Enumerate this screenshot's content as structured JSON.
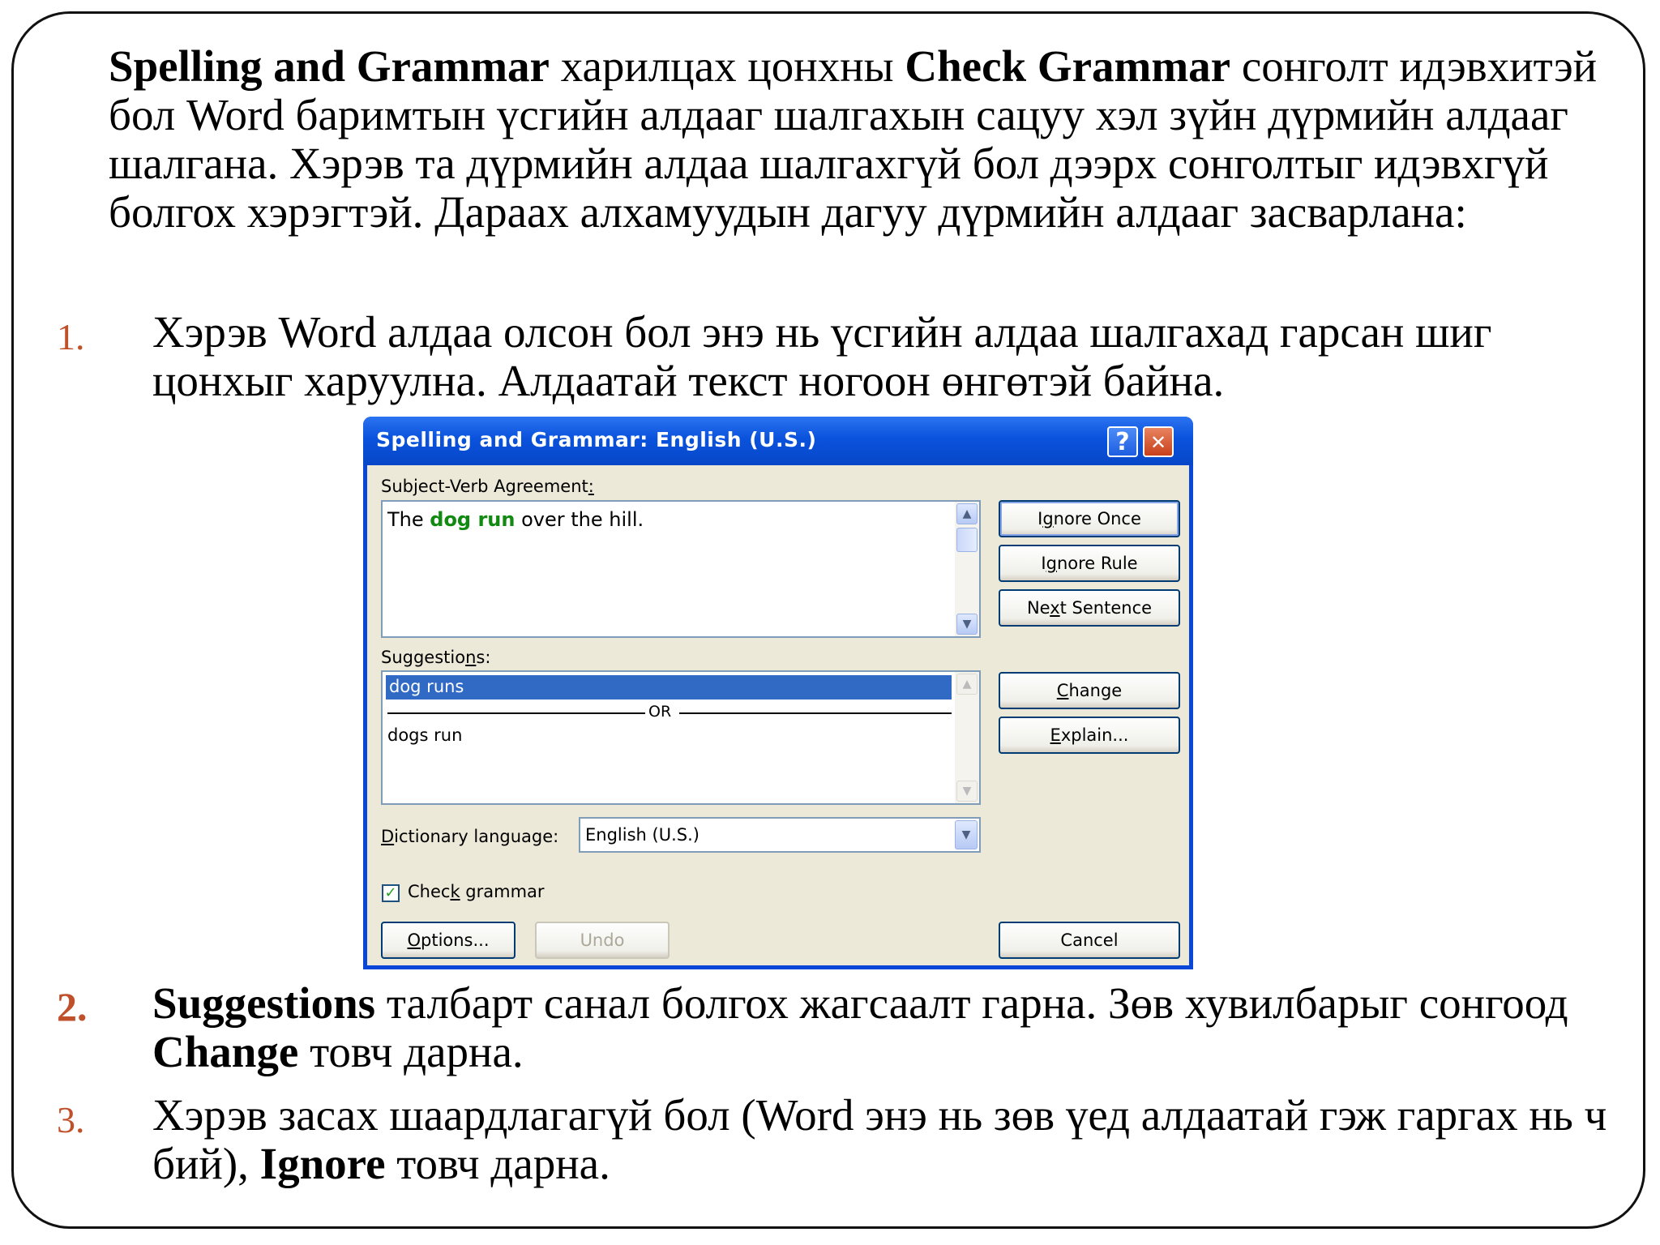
{
  "intro": {
    "bold1": "Spelling and Grammar",
    "text1": " харилцах цонхны ",
    "bold2": "Check Grammar",
    "text2": " сонголт идэвхитэй бол Word баримтын үсгийн алдааг шалгахын сацуу хэл зүйн дүрмийн алдааг шалгана. Хэрэв та дүрмийн алдаа шалгахгүй бол дээрх сонголтыг идэвхгүй болгох хэрэгтэй. Дараах алхамуудын дагуу дүрмийн алдааг засварлана:"
  },
  "steps": [
    {
      "num": "1.",
      "text": "Хэрэв Word алдаа олсон бол энэ нь үсгийн алдаа шалгахад гарсан шиг цонхыг харуулна. Алдаатай текст ногоон өнгөтэй байна."
    },
    {
      "num": "2.",
      "bold1": "Suggestions",
      "text1": " талбарт санал болгох жагсаалт гарна. Зөв хувилбарыг сонгоод ",
      "bold2": "Change",
      "text2": " товч дарна."
    },
    {
      "num": "3.",
      "text1": "Хэрэв засах шаардлагагүй бол (Word энэ нь зөв үед  алдаатай гэж гаргах нь ч бий), ",
      "bold1": "Ignore",
      "text2": " товч дарна."
    }
  ],
  "dialog": {
    "title": "Spelling and Grammar: English (U.S.)",
    "help_glyph": "?",
    "close_glyph": "✕",
    "error_label_pre": "Subject-Verb Agreement",
    "error_label_acc": ":",
    "sentence": {
      "pre": "The ",
      "error": "dog run",
      "post": " over the hill."
    },
    "suggestions_label_pre": "Suggestio",
    "suggestions_label_acc": "n",
    "suggestions_label_post": "s:",
    "suggestions": [
      "dog runs",
      "dogs run"
    ],
    "or_text": "OR",
    "dictionary_label_acc": "D",
    "dictionary_label_post": "ictionary language:",
    "dictionary_value": "English (U.S.)",
    "check_grammar_pre": "Chec",
    "check_grammar_acc": "k",
    "check_grammar_post": " grammar",
    "check_grammar_checked": "✓",
    "buttons": {
      "ignore_once_pre": "I",
      "ignore_once_acc": "g",
      "ignore_once_post": "nore Once",
      "ignore_rule_pre": "I",
      "ignore_rule_acc": "g",
      "ignore_rule_post": "nore Rule",
      "next_pre": "Ne",
      "next_acc": "x",
      "next_post": "t Sentence",
      "change_acc": "C",
      "change_post": "hange",
      "explain_acc": "E",
      "explain_post": "xplain...",
      "options_acc": "O",
      "options_post": "ptions...",
      "undo": "Undo",
      "cancel": "Cancel"
    },
    "arrow_up": "▲",
    "arrow_down": "▼"
  },
  "colors": {
    "title_blue": "#0a52dc",
    "error_green": "#108a10",
    "number_accent": "#c0502a",
    "selection": "#316ac5"
  }
}
